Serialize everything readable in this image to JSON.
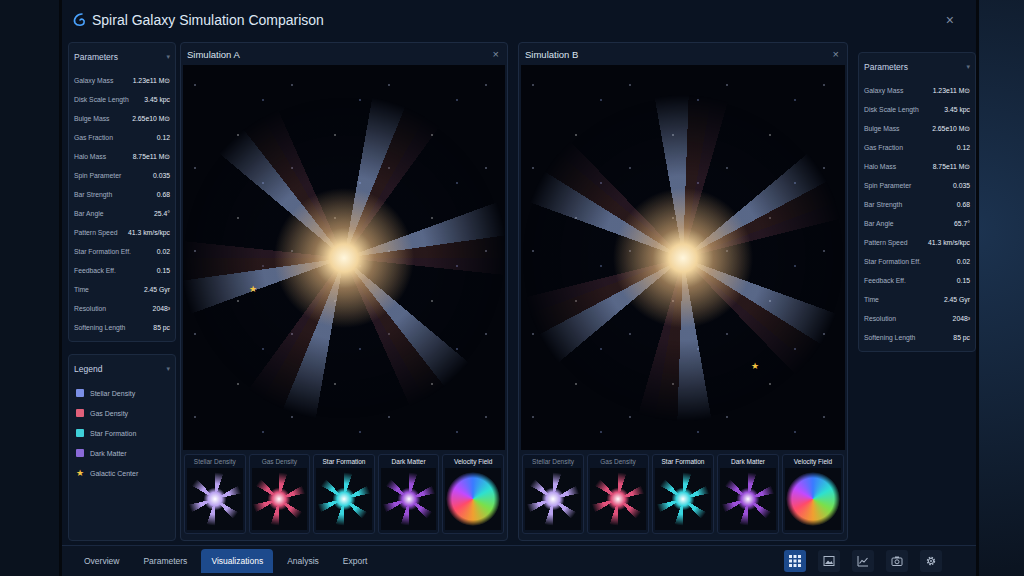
{
  "window": {
    "title": "Spiral Galaxy Simulation Comparison",
    "close": "×"
  },
  "left_parameters": {
    "title": "Parameters",
    "chevron": "▾",
    "rows": [
      {
        "label": "Galaxy Mass",
        "value": "1.23e11 M⊙"
      },
      {
        "label": "Disk Scale Length",
        "value": "3.45 kpc"
      },
      {
        "label": "Bulge Mass",
        "value": "2.65e10 M⊙"
      },
      {
        "label": "Gas Fraction",
        "value": "0.12"
      },
      {
        "label": "Halo Mass",
        "value": "8.75e11 M⊙"
      },
      {
        "label": "Spin Parameter",
        "value": "0.035"
      },
      {
        "label": "Bar Strength",
        "value": "0.68"
      },
      {
        "label": "Bar Angle",
        "value": "25.4°"
      },
      {
        "label": "Pattern Speed",
        "value": "41.3 km/s/kpc"
      },
      {
        "label": "Star Formation Eff.",
        "value": "0.02"
      },
      {
        "label": "Feedback Eff.",
        "value": "0.15"
      },
      {
        "label": "Time",
        "value": "2.45 Gyr"
      },
      {
        "label": "Resolution",
        "value": "2048³"
      },
      {
        "label": "Softening Length",
        "value": "85 pc"
      }
    ]
  },
  "legend": {
    "title": "Legend",
    "chevron": "▾",
    "items": [
      {
        "label": "Stellar Density",
        "kind": "swatch",
        "glyph": "",
        "color": "#7b8fe6"
      },
      {
        "label": "Gas Density",
        "kind": "swatch",
        "glyph": "",
        "color": "#e0607a"
      },
      {
        "label": "Star Formation",
        "kind": "swatch",
        "glyph": "",
        "color": "#3fd0d8"
      },
      {
        "label": "Dark Matter",
        "kind": "swatch",
        "glyph": "",
        "color": "#8a6ad8"
      },
      {
        "label": "Galactic Center",
        "kind": "star",
        "glyph": "★",
        "color": "#f5c542"
      }
    ]
  },
  "simulations": [
    {
      "title": "Simulation A",
      "close": "×",
      "center_marker": "★",
      "views": [
        {
          "label": "Stellar Density",
          "kind": "density",
          "dimmed": true,
          "color": "#b9a2f0"
        },
        {
          "label": "Gas Density",
          "kind": "density",
          "dimmed": true,
          "color": "#e0507a"
        },
        {
          "label": "Star Formation",
          "kind": "density",
          "dimmed": false,
          "color": "#38d6e0"
        },
        {
          "label": "Dark Matter",
          "kind": "density",
          "dimmed": false,
          "color": "#9a4fd8"
        },
        {
          "label": "Velocity Field",
          "kind": "velocity",
          "dimmed": false,
          "color": "#f0a030"
        }
      ]
    },
    {
      "title": "Simulation B",
      "close": "×",
      "center_marker": "★",
      "views": [
        {
          "label": "Stellar Density",
          "kind": "density",
          "dimmed": true,
          "color": "#b9a2f0"
        },
        {
          "label": "Gas Density",
          "kind": "density",
          "dimmed": true,
          "color": "#e0507a"
        },
        {
          "label": "Star Formation",
          "kind": "density",
          "dimmed": false,
          "color": "#38d6e0"
        },
        {
          "label": "Dark Matter",
          "kind": "density",
          "dimmed": false,
          "color": "#9a4fd8"
        },
        {
          "label": "Velocity Field",
          "kind": "velocity",
          "dimmed": false,
          "color": "#f0a030"
        }
      ]
    }
  ],
  "right_parameters": {
    "title": "Parameters",
    "chevron": "▾",
    "rows": [
      {
        "label": "Galaxy Mass",
        "value": "1.23e11 M⊙"
      },
      {
        "label": "Disk Scale Length",
        "value": "3.45 kpc"
      },
      {
        "label": "Bulge Mass",
        "value": "2.65e10 M⊙"
      },
      {
        "label": "Gas Fraction",
        "value": "0.12"
      },
      {
        "label": "Halo Mass",
        "value": "8.75e11 M⊙"
      },
      {
        "label": "Spin Parameter",
        "value": "0.035"
      },
      {
        "label": "Bar Strength",
        "value": "0.68"
      },
      {
        "label": "Bar Angle",
        "value": "65.7°"
      },
      {
        "label": "Pattern Speed",
        "value": "41.3 km/s/kpc"
      },
      {
        "label": "Star Formation Eff.",
        "value": "0.02"
      },
      {
        "label": "Feedback Eff.",
        "value": "0.15"
      },
      {
        "label": "Time",
        "value": "2.45 Gyr"
      },
      {
        "label": "Resolution",
        "value": "2048³"
      },
      {
        "label": "Softening Length",
        "value": "85 pc"
      }
    ]
  },
  "tabs": [
    {
      "label": "Overview",
      "selected": false
    },
    {
      "label": "Parameters",
      "selected": false
    },
    {
      "label": "Visualizations",
      "selected": true
    },
    {
      "label": "Analysis",
      "selected": false
    },
    {
      "label": "Export",
      "selected": false
    }
  ],
  "tools": [
    {
      "kind": "grid",
      "selected": true
    },
    {
      "kind": "image",
      "selected": false
    },
    {
      "kind": "chart",
      "selected": false
    },
    {
      "kind": "camera",
      "selected": false
    },
    {
      "kind": "gear",
      "selected": false
    }
  ]
}
